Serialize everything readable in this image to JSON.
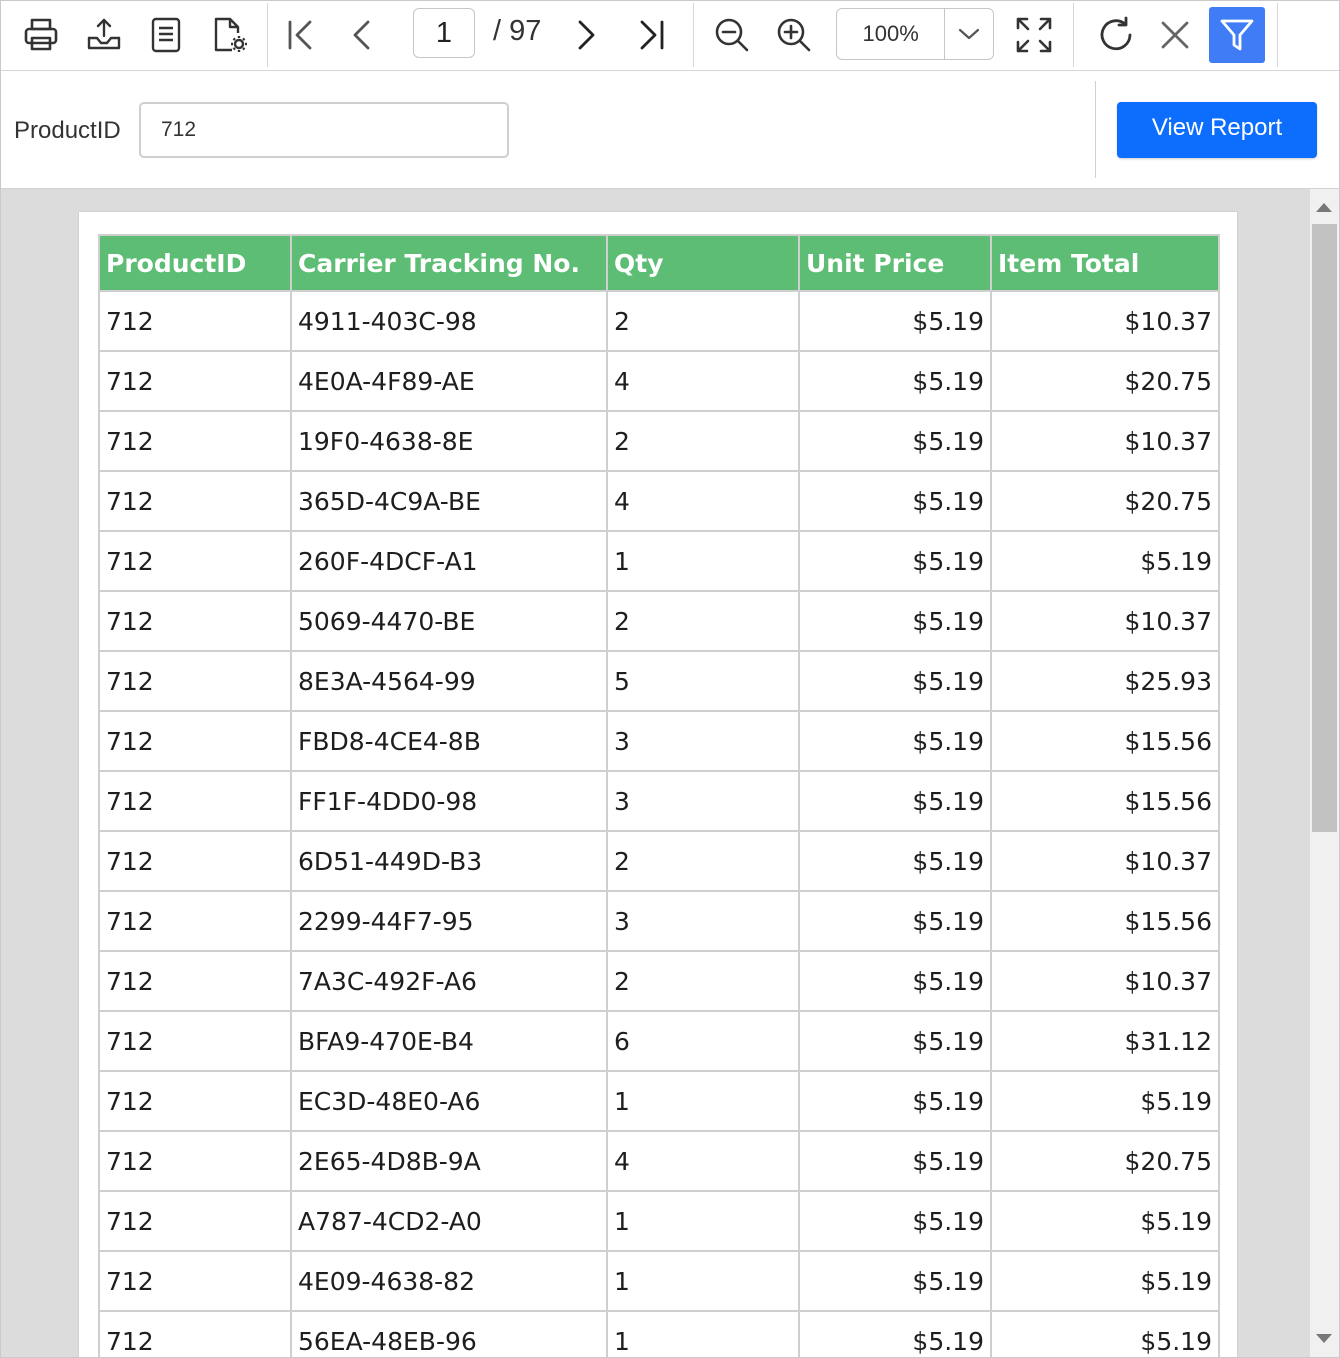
{
  "toolbar": {
    "icons": [
      "print-icon",
      "export-icon",
      "page-setup-icon",
      "print-layout-settings-icon",
      "first-page-icon",
      "previous-page-icon",
      "next-page-icon",
      "last-page-icon",
      "zoom-out-icon",
      "zoom-in-icon",
      "fit-page-icon",
      "refresh-icon",
      "close-icon",
      "filter-icon"
    ],
    "current_page": "1",
    "total_pages": "/ 97",
    "zoom": "100%",
    "accent_color": "#3f7cf5"
  },
  "parameters": {
    "label": "ProductID",
    "value": "712",
    "view_button": "View Report",
    "button_color": "#0d6efd"
  },
  "report": {
    "header_color": "#5dbd74",
    "columns": [
      "ProductID",
      "Carrier Tracking No.",
      "Qty",
      "Unit Price",
      "Item Total"
    ],
    "rows": [
      [
        "712",
        "4911-403C-98",
        "2",
        "$5.19",
        "$10.37"
      ],
      [
        "712",
        "4E0A-4F89-AE",
        "4",
        "$5.19",
        "$20.75"
      ],
      [
        "712",
        "19F0-4638-8E",
        "2",
        "$5.19",
        "$10.37"
      ],
      [
        "712",
        "365D-4C9A-BE",
        "4",
        "$5.19",
        "$20.75"
      ],
      [
        "712",
        "260F-4DCF-A1",
        "1",
        "$5.19",
        "$5.19"
      ],
      [
        "712",
        "5069-4470-BE",
        "2",
        "$5.19",
        "$10.37"
      ],
      [
        "712",
        "8E3A-4564-99",
        "5",
        "$5.19",
        "$25.93"
      ],
      [
        "712",
        "FBD8-4CE4-8B",
        "3",
        "$5.19",
        "$15.56"
      ],
      [
        "712",
        "FF1F-4DD0-98",
        "3",
        "$5.19",
        "$15.56"
      ],
      [
        "712",
        "6D51-449D-B3",
        "2",
        "$5.19",
        "$10.37"
      ],
      [
        "712",
        "2299-44F7-95",
        "3",
        "$5.19",
        "$15.56"
      ],
      [
        "712",
        "7A3C-492F-A6",
        "2",
        "$5.19",
        "$10.37"
      ],
      [
        "712",
        "BFA9-470E-B4",
        "6",
        "$5.19",
        "$31.12"
      ],
      [
        "712",
        "EC3D-48E0-A6",
        "1",
        "$5.19",
        "$5.19"
      ],
      [
        "712",
        "2E65-4D8B-9A",
        "4",
        "$5.19",
        "$20.75"
      ],
      [
        "712",
        "A787-4CD2-A0",
        "1",
        "$5.19",
        "$5.19"
      ],
      [
        "712",
        "4E09-4638-82",
        "1",
        "$5.19",
        "$5.19"
      ],
      [
        "712",
        "56EA-48EB-96",
        "1",
        "$5.19",
        "$5.19"
      ]
    ]
  }
}
